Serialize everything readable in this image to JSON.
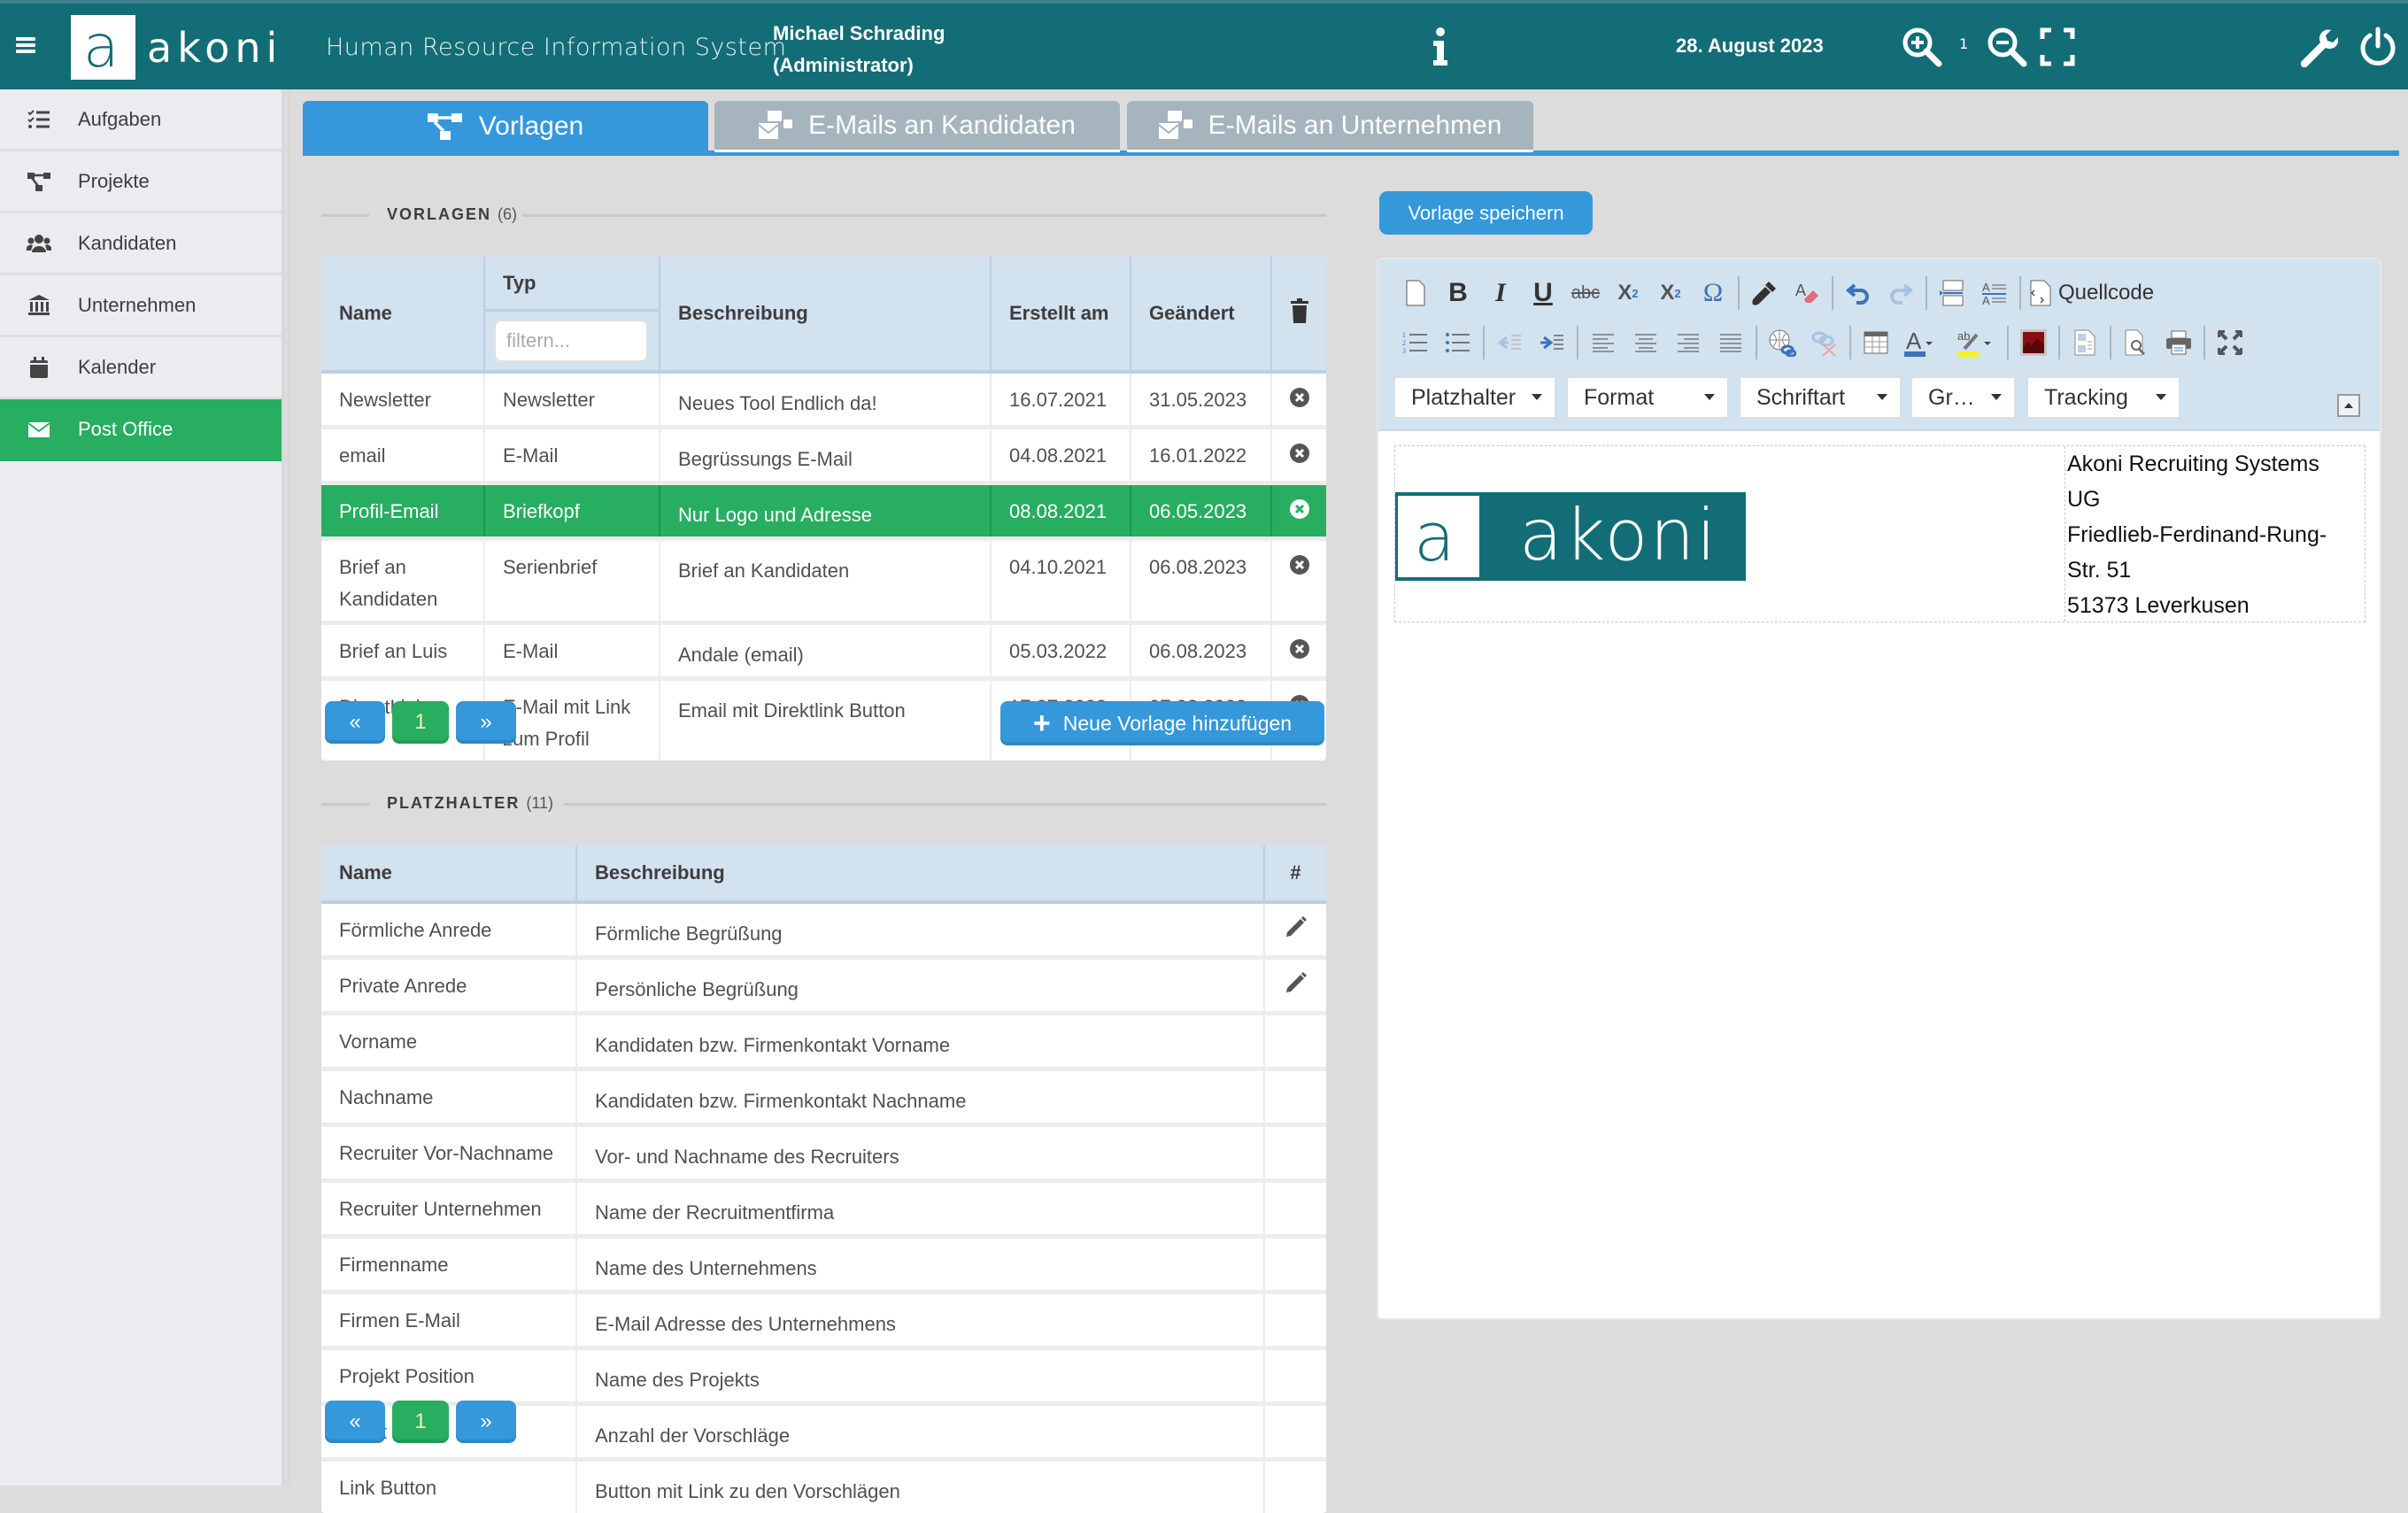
{
  "header": {
    "menu_icon": "hamburger-icon",
    "logo_letter": "a",
    "logo_text": "akoni",
    "app_title": "Human Resource Information System",
    "user_name": "Michael Schrading",
    "user_role": "(Administrator)",
    "date": "28. August 2023",
    "zoom_level": "1",
    "icons": [
      "info-icon",
      "zoom-in-icon",
      "zoom-out-icon",
      "fullscreen-icon",
      "wrench-icon",
      "power-icon"
    ]
  },
  "sidebar": {
    "items": [
      {
        "label": "Aufgaben",
        "icon": "tasks-icon",
        "active": false
      },
      {
        "label": "Projekte",
        "icon": "sitemap-icon",
        "active": false
      },
      {
        "label": "Kandidaten",
        "icon": "users-icon",
        "active": false
      },
      {
        "label": "Unternehmen",
        "icon": "bank-icon",
        "active": false
      },
      {
        "label": "Kalender",
        "icon": "calendar-icon",
        "active": false
      },
      {
        "label": "Post Office",
        "icon": "envelope-icon",
        "active": true
      }
    ]
  },
  "tabs": [
    {
      "label": "Vorlagen",
      "icon": "sitemap-icon",
      "active": true
    },
    {
      "label": "E-Mails an Kandidaten",
      "icon": "mail-bulk-icon",
      "active": false
    },
    {
      "label": "E-Mails an Unternehmen",
      "icon": "mail-bulk-icon",
      "active": false
    }
  ],
  "templates": {
    "title": "VORLAGEN",
    "count": "(6)",
    "columns": {
      "name": "Name",
      "type": "Typ",
      "description": "Beschreibung",
      "created": "Erstellt am",
      "changed": "Geändert"
    },
    "type_filter_placeholder": "filtern...",
    "rows": [
      {
        "name": "Newsletter",
        "type": "Newsletter",
        "description": "Neues Tool Endlich da!",
        "created": "16.07.2021",
        "changed": "31.05.2023",
        "selected": false
      },
      {
        "name": "email",
        "type": "E-Mail",
        "description": "Begrüssungs E-Mail",
        "created": "04.08.2021",
        "changed": "16.01.2022",
        "selected": false
      },
      {
        "name": "Profil-Email",
        "type": "Briefkopf",
        "description": "Nur Logo und Adresse",
        "created": "08.08.2021",
        "changed": "06.05.2023",
        "selected": true
      },
      {
        "name": "Brief an Kandidaten",
        "type": "Serienbrief",
        "description": "Brief an Kandidaten",
        "created": "04.10.2021",
        "changed": "06.08.2023",
        "selected": false
      },
      {
        "name": "Brief an Luis",
        "type": "E-Mail",
        "description": "Andale (email)",
        "created": "05.03.2022",
        "changed": "06.08.2023",
        "selected": false
      },
      {
        "name": "DirectLink",
        "type": "E-Mail mit Link zum Profil",
        "description": "Email mit Direktlink Button",
        "created": "17.07.2023",
        "changed": "07.08.2023",
        "selected": false
      }
    ],
    "pagination": {
      "prev": "«",
      "page": "1",
      "next": "»"
    },
    "add_button": "Neue Vorlage hinzufügen"
  },
  "placeholders": {
    "title": "PLATZHALTER",
    "count": "(11)",
    "columns": {
      "name": "Name",
      "description": "Beschreibung",
      "action": "#"
    },
    "rows": [
      {
        "name": "Förmliche Anrede",
        "description": "Förmliche Begrüßung",
        "editable": true
      },
      {
        "name": "Private Anrede",
        "description": "Persönliche Begrüßung",
        "editable": true
      },
      {
        "name": "Vorname",
        "description": "Kandidaten bzw. Firmenkontakt Vorname",
        "editable": false
      },
      {
        "name": "Nachname",
        "description": "Kandidaten bzw. Firmenkontakt Nachname",
        "editable": false
      },
      {
        "name": "Recruiter Vor-Nachname",
        "description": "Vor- und Nachname des Recruiters",
        "editable": false
      },
      {
        "name": "Recruiter Unternehmen",
        "description": "Name der Recruitmentfirma",
        "editable": false
      },
      {
        "name": "Firmenname",
        "description": "Name des Unternehmens",
        "editable": false
      },
      {
        "name": "Firmen E-Mail",
        "description": "E-Mail Adresse des Unternehmens",
        "editable": false
      },
      {
        "name": "Projekt Position",
        "description": "Name des Projekts",
        "editable": false
      },
      {
        "name": "count",
        "description": "Anzahl der Vorschläge",
        "editable": false
      },
      {
        "name": "Link Button",
        "description": "Button mit Link zu den Vorschlägen",
        "editable": false
      }
    ],
    "pagination": {
      "prev": "«",
      "page": "1",
      "next": "»"
    }
  },
  "editor": {
    "save_button": "Vorlage speichern",
    "source_label": "Quellcode",
    "combos": [
      "Platzhalter",
      "Format",
      "Schriftart",
      "Gr…",
      "Tracking"
    ],
    "document": {
      "logo_letter": "a",
      "logo_text": "akoni",
      "address_lines": [
        "Akoni Recruiting Systems",
        "UG",
        "Friedlieb-Ferdinand-Rung-",
        "Str. 51",
        "51373 Leverkusen"
      ]
    }
  },
  "colors": {
    "header": "#136d76",
    "active_green": "#27ae60",
    "primary_blue": "#3498db",
    "tab_inactive": "#a5b4bd",
    "table_header": "#d3e2ef"
  }
}
